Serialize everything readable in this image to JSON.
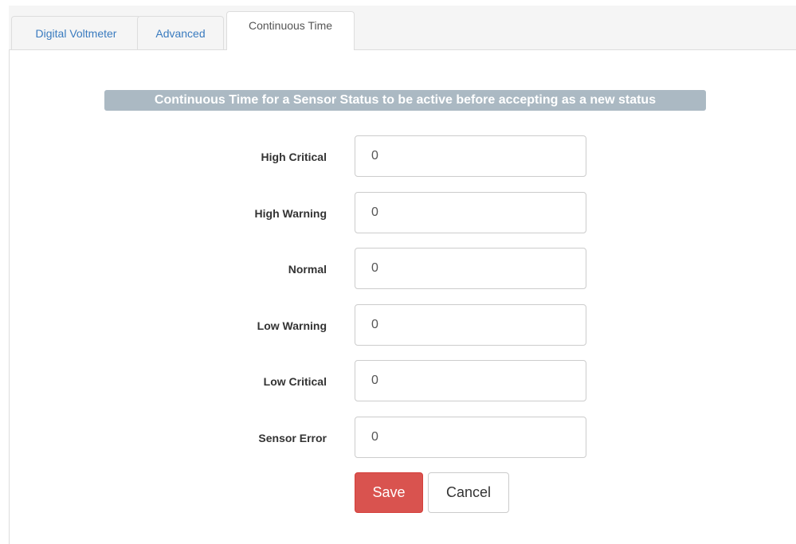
{
  "tabs": [
    {
      "label": "Digital Voltmeter",
      "active": false
    },
    {
      "label": "Advanced",
      "active": false
    },
    {
      "label": "Continuous Time",
      "active": true
    }
  ],
  "section_title": "Continuous Time for a Sensor Status to be active before accepting as a new status",
  "fields": [
    {
      "label": "High Critical",
      "value": "0"
    },
    {
      "label": "High Warning",
      "value": "0"
    },
    {
      "label": "Normal",
      "value": "0"
    },
    {
      "label": "Low Warning",
      "value": "0"
    },
    {
      "label": "Low Critical",
      "value": "0"
    },
    {
      "label": "Sensor Error",
      "value": "0"
    }
  ],
  "buttons": {
    "save_label": "Save",
    "cancel_label": "Cancel"
  },
  "colors": {
    "tab_link": "#3a7bbf",
    "section_title_bg": "#abb9c3",
    "save_bg": "#d9534f"
  }
}
